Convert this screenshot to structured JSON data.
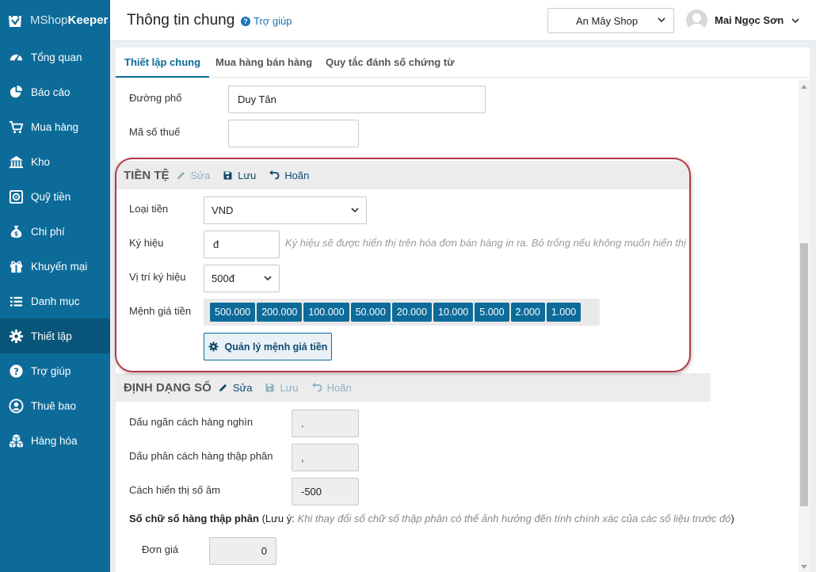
{
  "app": {
    "logo_light": "MShop",
    "logo_bold": "Keeper"
  },
  "sidebar": {
    "items": [
      {
        "label": "Tổng quan",
        "icon": "dashboard-icon"
      },
      {
        "label": "Báo cáo",
        "icon": "pie-chart-icon"
      },
      {
        "label": "Mua hàng",
        "icon": "cart-icon"
      },
      {
        "label": "Kho",
        "icon": "warehouse-icon"
      },
      {
        "label": "Quỹ tiền",
        "icon": "safe-icon"
      },
      {
        "label": "Chi phí",
        "icon": "money-bag-icon"
      },
      {
        "label": "Khuyến mại",
        "icon": "gift-icon"
      },
      {
        "label": "Danh mục",
        "icon": "list-icon"
      },
      {
        "label": "Thiết lập",
        "icon": "gear-icon",
        "active": true
      },
      {
        "label": "Trợ giúp",
        "icon": "question-icon"
      },
      {
        "label": "Thuê bao",
        "icon": "user-icon"
      },
      {
        "label": "Hàng hóa",
        "icon": "boxes-icon"
      }
    ]
  },
  "header": {
    "title": "Thông tin chung",
    "help": "Trợ giúp",
    "shop": "An Mây Shop",
    "user_name": "Mai Ngọc Sơn"
  },
  "tabs": [
    "Thiết lập chung",
    "Mua hàng bán hàng",
    "Quy tắc đánh số chứng từ"
  ],
  "address": {
    "street_label": "Đường phố",
    "street_value": "Duy Tân",
    "tax_label": "Mã số thuế",
    "tax_value": ""
  },
  "currency": {
    "title": "TIỀN TỆ",
    "edit": "Sửa",
    "save": "Lưu",
    "undo": "Hoãn",
    "type_label": "Loại tiền",
    "type_value": "VND",
    "symbol_label": "Ký hiệu",
    "symbol_value": "đ",
    "symbol_hint": "Ký hiệu sẽ được hiển thị trên hóa đơn bán hàng in ra. Bỏ trống nếu không muốn hiển thị",
    "position_label": "Vị trí ký hiệu",
    "position_value": "500đ",
    "denoms_label": "Mệnh giá tiền",
    "denominations": [
      "500.000",
      "200.000",
      "100.000",
      "50.000",
      "20.000",
      "10.000",
      "5.000",
      "2.000",
      "1.000"
    ],
    "manage_button": "Quản lý mệnh giá tiền"
  },
  "number_format": {
    "title": "ĐỊNH DẠNG SỐ",
    "edit": "Sửa",
    "save": "Lưu",
    "undo": "Hoãn",
    "thousands_label": "Dấu ngăn cách hàng nghìn",
    "thousands_value": ".",
    "decimal_label": "Dấu phân cách hàng thập phân",
    "decimal_value": ",",
    "negative_label": "Cách hiển thị số âm",
    "negative_value": "-500",
    "digits_bold": "Số chữ số hàng thập phân",
    "digits_open": " (Lưu ý: ",
    "digits_note": "Khi thay đổi số chữ số thập phân có thể ảnh hưởng đến tính chính xác của các số liệu trước đó",
    "digits_close": ")",
    "unit_price_label": "Đơn giá",
    "unit_price_value": "0"
  },
  "colors": {
    "sidebar": "#0c6b99",
    "sidebar_active": "#095579",
    "accent": "#0c6b99",
    "highlight": "#b33a45"
  }
}
